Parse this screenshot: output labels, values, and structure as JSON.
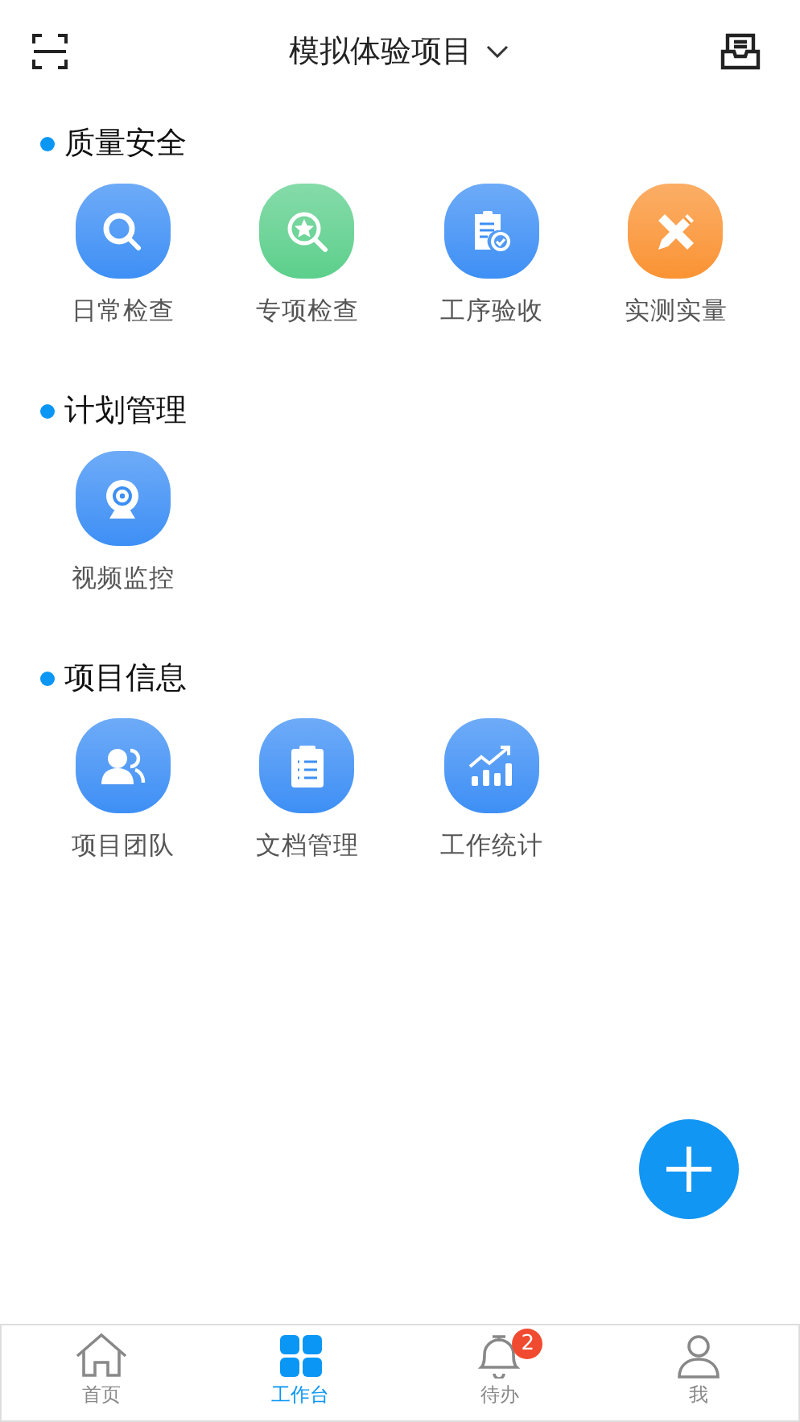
{
  "header": {
    "title": "模拟体验项目"
  },
  "sections": [
    {
      "title": "质量安全",
      "items": [
        {
          "label": "日常检查",
          "color": "#3d8ff5"
        },
        {
          "label": "专项检查",
          "color": "#5ccf8c"
        },
        {
          "label": "工序验收",
          "color": "#3d8ff5"
        },
        {
          "label": "实测实量",
          "color": "#fa9332"
        }
      ]
    },
    {
      "title": "计划管理",
      "items": [
        {
          "label": "视频监控",
          "color": "#3d8ff5"
        }
      ]
    },
    {
      "title": "项目信息",
      "items": [
        {
          "label": "项目团队",
          "color": "#3d8ff5"
        },
        {
          "label": "文档管理",
          "color": "#3d8ff5"
        },
        {
          "label": "工作统计",
          "color": "#3d8ff5"
        }
      ]
    }
  ],
  "tabbar": [
    {
      "label": "首页",
      "selected": false
    },
    {
      "label": "工作台",
      "selected": true
    },
    {
      "label": "待办",
      "selected": false,
      "badge": "2"
    },
    {
      "label": "我",
      "selected": false
    }
  ]
}
